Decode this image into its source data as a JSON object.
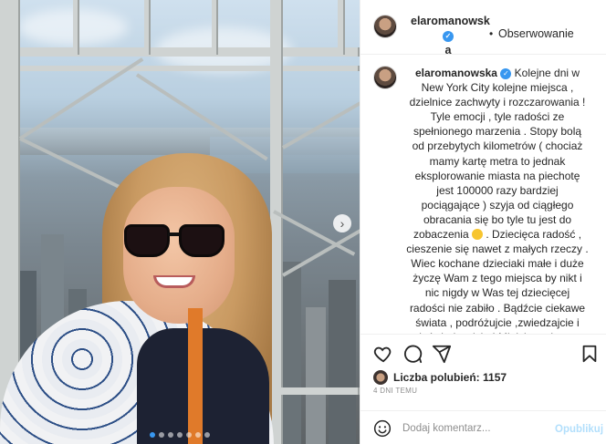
{
  "post": {
    "username": "elaromanowska",
    "header_username_line1": "elaromanowsk",
    "header_username_line2": "a",
    "follow_label": "Obserwowanie",
    "separator": "•",
    "caption_username": "elaromanowska",
    "caption_text": "Kolejne dni w New York City kolejne miejsca , dzielnice zachwyty i rozczarowania ! Tyle emocji , tyle radości ze spełnionego marzenia . Stopy bolą od przebytych kilometrów ( chociaż mamy kartę metra to jednak eksplorowanie miasta na piechotę jest 100000 razy bardziej pociągające ) szyja od ciągłego obracania się bo tyle tu jest do zobaczenia",
    "caption_text_2": ". Dziecięca radość , cieszenie się nawet z małych rzeczy . Wiec kochane dzieciaki małe i duże życzę Wam z tego miejsca by nikt i nic nigdy w Was tej dziecięcej radości nie zabiło . Bądźcie ciekawe świata , podróżujcie ,zwiedzajcie i doświadczajcie ! Miejcie cudowne marzenia i realizujcie je !!! A ja lecę uczcić ten dzień dziecka z cudowna , madra i piekielnie zdolna",
    "likes_label": "Liczba polubień:",
    "likes_count": "1157",
    "timestamp": "4 DNI TEMU",
    "carousel_index": 0,
    "carousel_total": 7
  },
  "comment": {
    "placeholder": "Dodaj komentarz...",
    "publish_label": "Opublikuj"
  },
  "icons": {
    "like": "heart-icon",
    "comment": "comment-icon",
    "share": "share-icon",
    "save": "bookmark-icon",
    "verified": "verified-badge-icon",
    "emoji": "emoji-icon",
    "carousel_next": "chevron-right-icon"
  },
  "colors": {
    "verified": "#3897f0",
    "active_dot": "#3897f0",
    "publish_disabled": "#b2dffc"
  }
}
